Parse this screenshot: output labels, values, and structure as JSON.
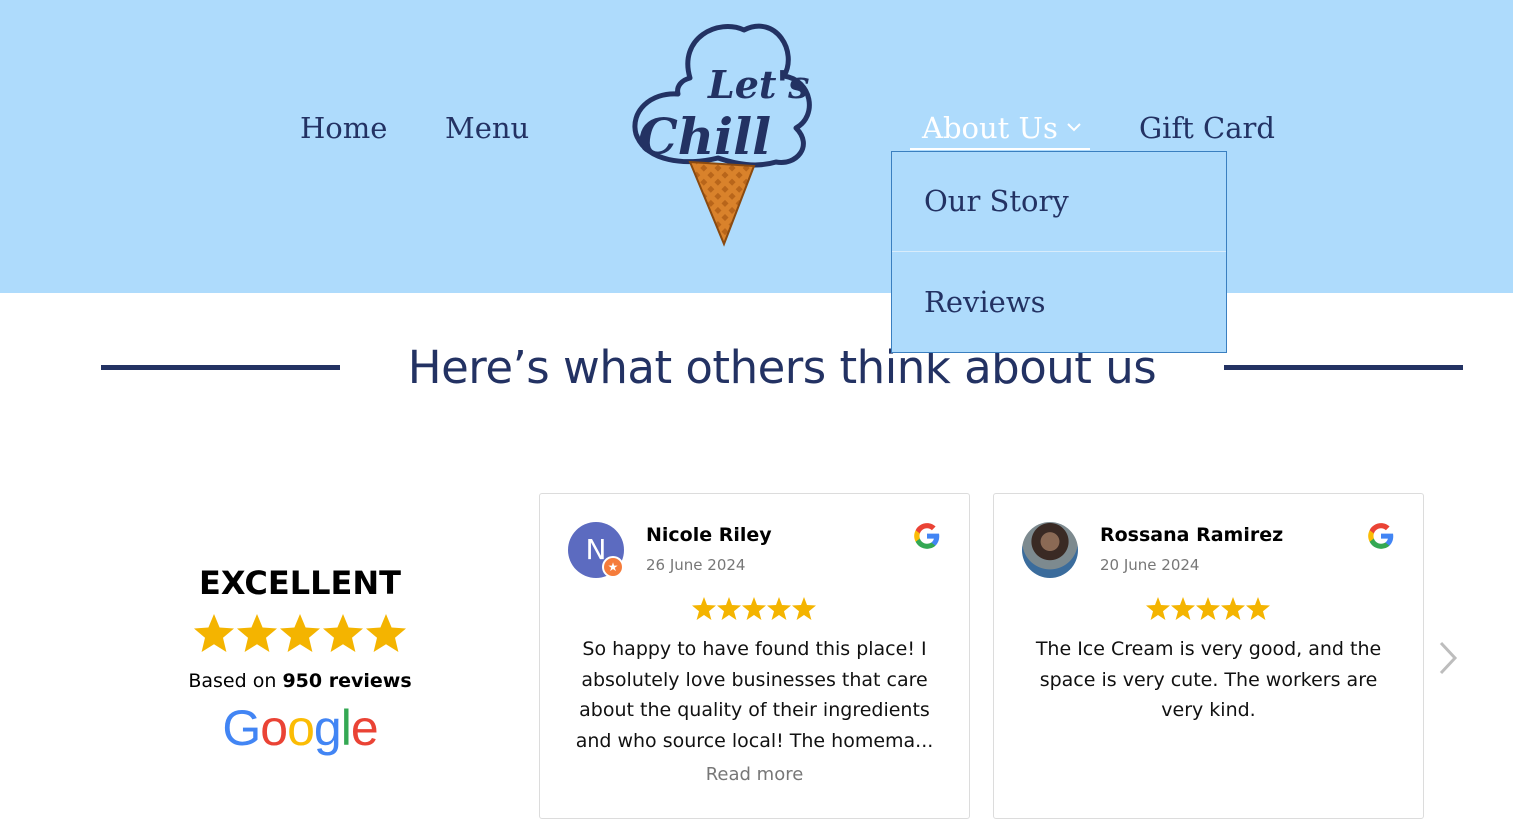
{
  "nav": {
    "home": "Home",
    "menu": "Menu",
    "about": "About Us",
    "gift_card": "Gift Card",
    "chevron_icon": "chevron-down-icon"
  },
  "logo": {
    "text_top": "Let's",
    "text_bottom": "Chill"
  },
  "dropdown": {
    "items": [
      {
        "label": "Our Story"
      },
      {
        "label": "Reviews"
      }
    ]
  },
  "section": {
    "heading": "Here’s what others think about us"
  },
  "summary": {
    "rating_word": "EXCELLENT",
    "stars": 5,
    "based_prefix": "Based on",
    "review_count": "950 reviews",
    "provider": "Google"
  },
  "reviews": [
    {
      "initial": "N",
      "name": "Nicole Riley",
      "date": "26 June 2024",
      "stars": 5,
      "text": "So happy to have found this place! I absolutely love businesses that care about the quality of their ingredients and who source local! The homema...",
      "read_more": "Read more"
    },
    {
      "initial": "",
      "name": "Rossana Ramirez",
      "date": "20 June 2024",
      "stars": 5,
      "text": "The Ice Cream is very good, and the space is very cute. The workers are very kind."
    }
  ],
  "colors": {
    "header_bg": "#aedbfc",
    "navy": "#233263",
    "star": "#f4b400"
  }
}
